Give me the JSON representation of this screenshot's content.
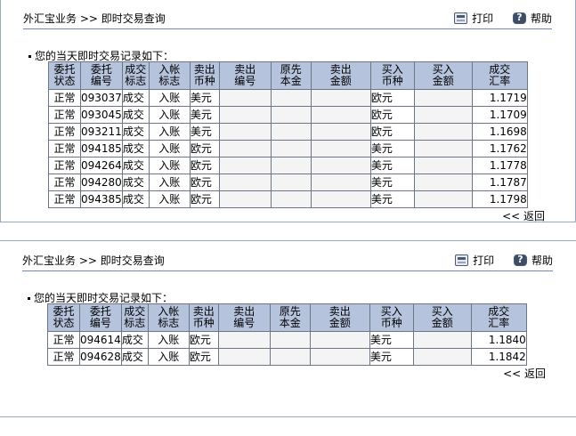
{
  "panel1": {
    "title": "外汇宝业务 >> 即时交易查询",
    "print": "打印",
    "help": "帮助",
    "caption": "您的当天即时交易记录如下：",
    "headers": [
      [
        "委托",
        "状态"
      ],
      [
        "委托",
        "编号"
      ],
      [
        "成交",
        "标志"
      ],
      [
        "入帐",
        "标志"
      ],
      [
        "卖出",
        "币种"
      ],
      [
        "卖出",
        "编号"
      ],
      [
        "原先",
        "本金"
      ],
      [
        "卖出",
        "金额"
      ],
      [
        "买入",
        "币种"
      ],
      [
        "买入",
        "金额"
      ],
      [
        "成交",
        "汇率"
      ]
    ],
    "rows": [
      [
        "正常",
        "093037",
        "成交",
        "入账",
        "美元",
        "欧元",
        "1.1719"
      ],
      [
        "正常",
        "093045",
        "成交",
        "入账",
        "美元",
        "欧元",
        "1.1709"
      ],
      [
        "正常",
        "093211",
        "成交",
        "入账",
        "美元",
        "欧元",
        "1.1698"
      ],
      [
        "正常",
        "094185",
        "成交",
        "入账",
        "欧元",
        "美元",
        "1.1762"
      ],
      [
        "正常",
        "094264",
        "成交",
        "入账",
        "欧元",
        "美元",
        "1.1778"
      ],
      [
        "正常",
        "094280",
        "成交",
        "入账",
        "欧元",
        "美元",
        "1.1787"
      ],
      [
        "正常",
        "094385",
        "成交",
        "入账",
        "欧元",
        "美元",
        "1.1798"
      ]
    ],
    "back": "<< 返回"
  },
  "panel2": {
    "title": "外汇宝业务 >> 即时交易查询",
    "print": "打印",
    "help": "帮助",
    "caption": "您的当天即时交易记录如下：",
    "headers": [
      [
        "委托",
        "状态"
      ],
      [
        "委托",
        "编号"
      ],
      [
        "成交",
        "标志"
      ],
      [
        "入帐",
        "标志"
      ],
      [
        "卖出",
        "币种"
      ],
      [
        "卖出",
        "编号"
      ],
      [
        "原先",
        "本金"
      ],
      [
        "卖出",
        "金额"
      ],
      [
        "买入",
        "币种"
      ],
      [
        "买入",
        "金额"
      ],
      [
        "成交",
        "汇率"
      ]
    ],
    "rows": [
      [
        "正常",
        "094614",
        "成交",
        "入账",
        "欧元",
        "美元",
        "1.1840"
      ],
      [
        "正常",
        "094628",
        "成交",
        "入账",
        "欧元",
        "美元",
        "1.1842"
      ]
    ],
    "back": "<< 返回"
  }
}
